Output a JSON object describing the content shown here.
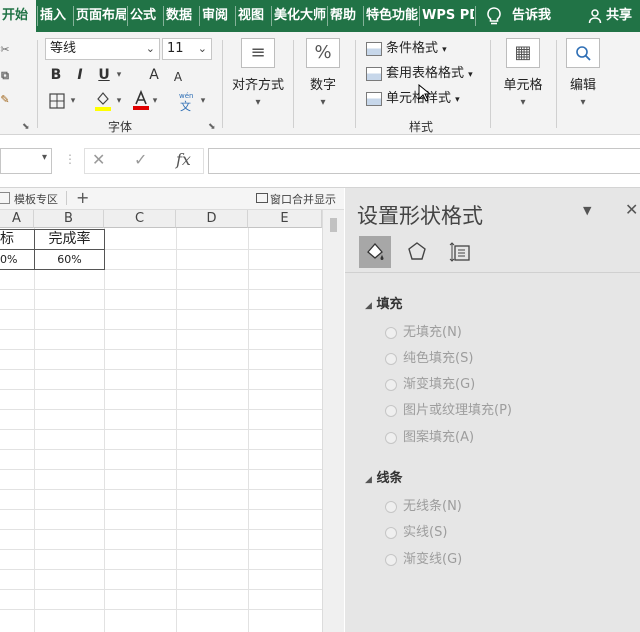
{
  "ribbon": {
    "tabs": [
      "开始",
      "插入",
      "页面布局",
      "公式",
      "数据",
      "审阅",
      "视图",
      "美化大师",
      "帮助",
      "特色功能",
      "WPS PDF",
      "告诉我",
      "共享"
    ],
    "font_name": "等线",
    "font_size": "11",
    "font_buttons": [
      "B",
      "I",
      "U",
      "A",
      "A"
    ],
    "group_font_label": "字体",
    "align_label": "对齐方式",
    "number_label": "数字",
    "conditional_format": "条件格式",
    "table_format": "套用表格格式",
    "cell_style": "单元格样式",
    "group_style_label": "样式",
    "cells_label": "单元格",
    "edit_label": "编辑"
  },
  "formula": {
    "fx": "fx",
    "value": ""
  },
  "sheet": {
    "tab_template": "模板专区",
    "add_tab": "+",
    "window_merge": "窗口合并显示",
    "columns": [
      "A",
      "B",
      "C",
      "D",
      "E"
    ],
    "cells": {
      "A1": "标",
      "B1": "完成率",
      "A2": "0%",
      "B2": "60%"
    }
  },
  "pane": {
    "title": "设置形状格式",
    "fill_section": "填充",
    "fill_options": [
      "无填充(N)",
      "纯色填充(S)",
      "渐变填充(G)",
      "图片或纹理填充(P)",
      "图案填充(A)"
    ],
    "line_section": "线条",
    "line_options": [
      "无线条(N)",
      "实线(S)",
      "渐变线(G)"
    ]
  }
}
